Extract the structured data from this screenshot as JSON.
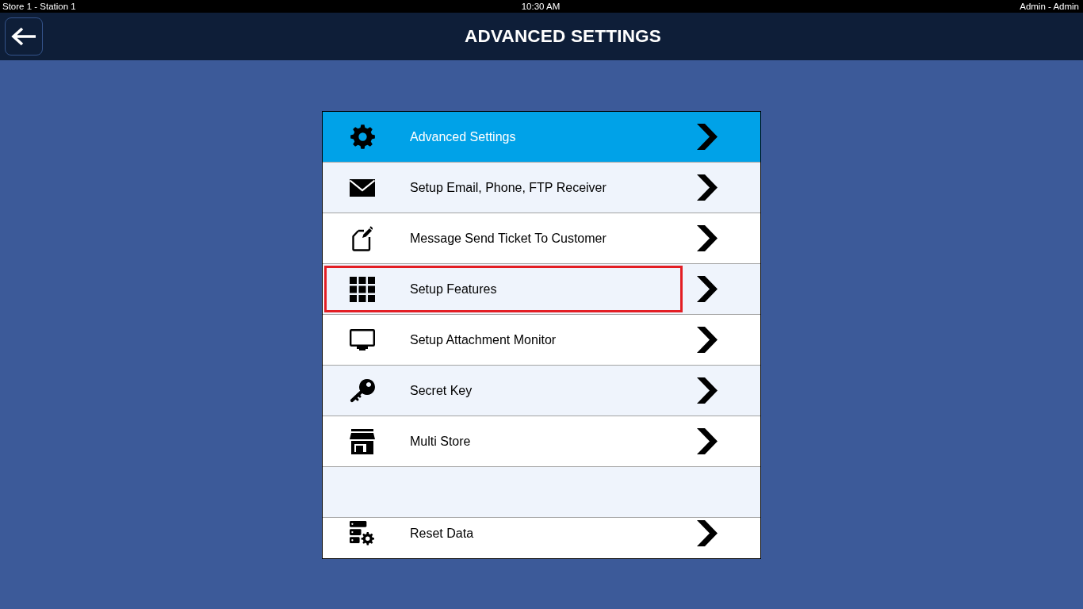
{
  "status_bar": {
    "location": "Store 1 - Station 1",
    "time": "10:30 AM",
    "user": "Admin - Admin"
  },
  "header": {
    "title": "ADVANCED SETTINGS"
  },
  "menu": {
    "items": [
      {
        "kind": "option",
        "label": "Advanced Settings",
        "selected": true,
        "highlighted": false
      },
      {
        "kind": "option",
        "label": "Setup Email, Phone, FTP Receiver",
        "selected": false,
        "highlighted": false
      },
      {
        "kind": "option",
        "label": "Message Send Ticket To Customer",
        "selected": false,
        "highlighted": false
      },
      {
        "kind": "option",
        "label": "Setup Features",
        "selected": false,
        "highlighted": true
      },
      {
        "kind": "option",
        "label": "Setup Attachment Monitor",
        "selected": false,
        "highlighted": false
      },
      {
        "kind": "option",
        "label": "Secret Key",
        "selected": false,
        "highlighted": false
      },
      {
        "kind": "option",
        "label": "Multi Store",
        "selected": false,
        "highlighted": false
      },
      {
        "kind": "blank",
        "selected": false,
        "highlighted": false
      },
      {
        "kind": "option",
        "label": "Reset Data",
        "selected": false,
        "highlighted": false
      }
    ]
  }
}
